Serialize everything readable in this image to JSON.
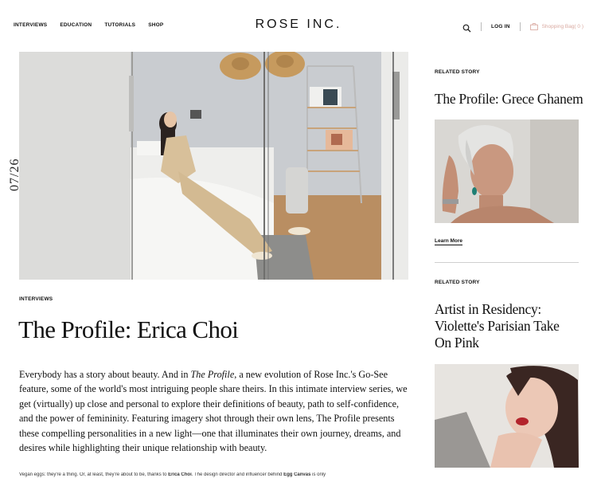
{
  "nav": {
    "items": [
      {
        "label": "INTERVIEWS"
      },
      {
        "label": "EDUCATION"
      },
      {
        "label": "TUTORIALS"
      },
      {
        "label": "SHOP"
      }
    ]
  },
  "brand": {
    "logo": "ROSE INC."
  },
  "tools": {
    "search_icon": "search-icon",
    "login_label": "LOG IN",
    "bag_label": "Shopping Bag( 0 )",
    "bag_icon": "shopping-bag-icon",
    "bag_color": "#d9a9a0"
  },
  "article": {
    "date": "07/26",
    "category": "INTERVIEWS",
    "title": "The Profile: Erica Choi",
    "intro_before": "Everybody has a story about beauty. And in ",
    "intro_em": "The Profile",
    "intro_after": ", a new evolution of Rose Inc.'s Go-See feature, some of the world's most intriguing people share theirs. In this intimate interview series, we get (virtually) up close and personal to explore their definitions of beauty, path to self-confidence, and the power of femininity. Featuring imagery shot through their own lens, The Profile presents these compelling personalities in a new light—one that illuminates their own journey, dreams, and desires while highlighting their unique relationship with beauty.",
    "body_a": "Vegan eggs: they're a thing. Or, at least, they're about to be, thanks to ",
    "body_b": "Erica Choi",
    "body_c": ". The design director and influencer behind ",
    "body_d": "Egg Canvas",
    "body_e": " is only"
  },
  "sidebar": {
    "stories": [
      {
        "label": "RELATED STORY",
        "title": "The Profile: Grece Ghanem",
        "link": "Learn More"
      },
      {
        "label": "RELATED STORY",
        "title": "Artist in Residency: Violette's Parisian Take On Pink"
      }
    ]
  }
}
